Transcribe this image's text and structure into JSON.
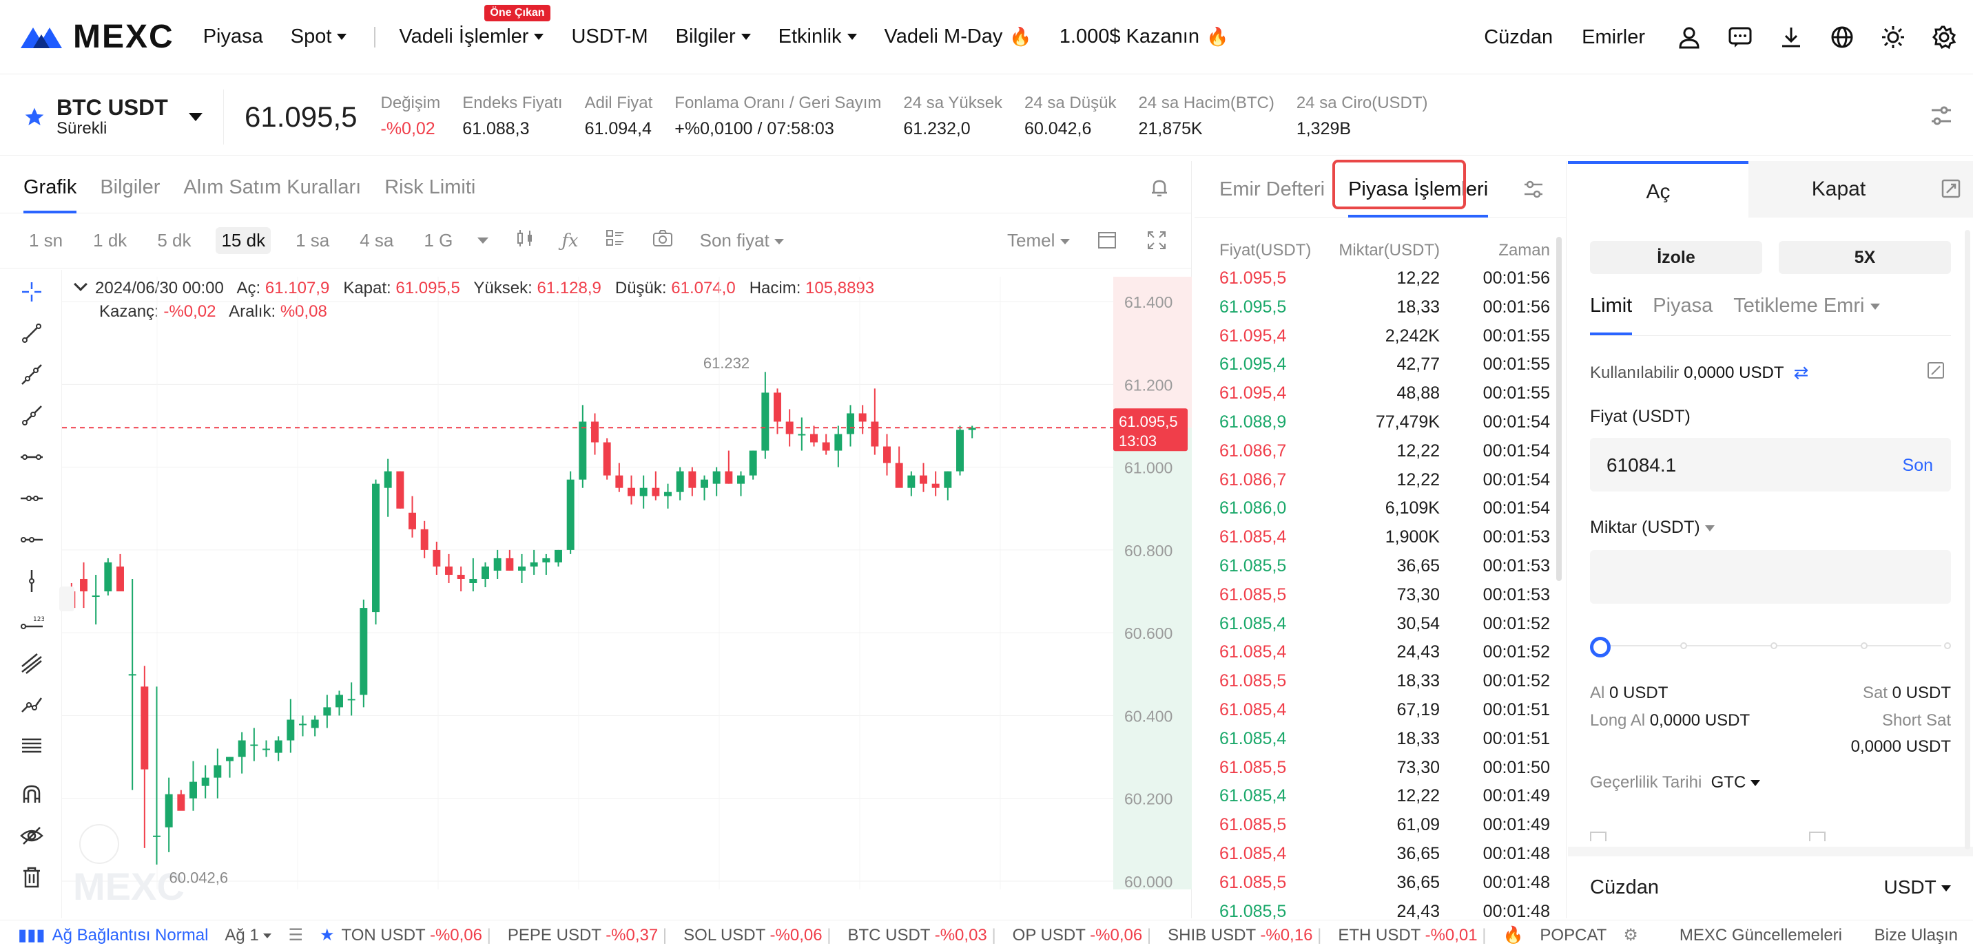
{
  "nav": {
    "logo": "MEXC",
    "items": [
      "Piyasa",
      "Spot",
      "Vadeli İşlemler",
      "USDT-M",
      "Bilgiler",
      "Etkinlik",
      "Vadeli M-Day",
      "1.000$ Kazanın"
    ],
    "badge": "Öne Çıkan",
    "right": [
      "Cüzdan",
      "Emirler"
    ]
  },
  "ticker": {
    "symbol": "BTC USDT",
    "type": "Sürekli",
    "price": "61.095,5",
    "stats": [
      {
        "label": "Değişim",
        "value": "-%0,02",
        "tone": "red"
      },
      {
        "label": "Endeks Fiyatı",
        "value": "61.088,3",
        "tone": ""
      },
      {
        "label": "Adil Fiyat",
        "value": "61.094,4",
        "tone": ""
      },
      {
        "label": "Fonlama Oranı / Geri Sayım",
        "value": "+%0,0100 / 07:58:03",
        "tone": ""
      },
      {
        "label": "24 sa Yüksek",
        "value": "61.232,0",
        "tone": ""
      },
      {
        "label": "24 sa Düşük",
        "value": "60.042,6",
        "tone": ""
      },
      {
        "label": "24 sa Hacim(BTC)",
        "value": "21,875K",
        "tone": ""
      },
      {
        "label": "24 sa Ciro(USDT)",
        "value": "1,329B",
        "tone": ""
      }
    ]
  },
  "chart_tabs": [
    "Grafik",
    "Bilgiler",
    "Alım Satım Kuralları",
    "Risk Limiti"
  ],
  "toolbar": {
    "timeframes": [
      "1 sn",
      "1 dk",
      "5 dk",
      "15 dk",
      "1 sa",
      "4 sa",
      "1 G"
    ],
    "price_type": "Son fiyat",
    "mode": "Temel"
  },
  "ohlc": {
    "date": "2024/06/30 00:00",
    "open_l": "Aç:",
    "open": "61.107,9",
    "close_l": "Kapat:",
    "close": "61.095,5",
    "high_l": "Yüksek:",
    "high": "61.128,9",
    "low_l": "Düşük:",
    "low": "61.074,0",
    "vol_l": "Hacim:",
    "vol": "105,8893",
    "pnl_l": "Kazanç:",
    "pnl": "-%0,02",
    "range_l": "Aralık:",
    "range": "%0,08"
  },
  "chart_data": {
    "type": "candlestick",
    "y_ticks": [
      "61.400",
      "61.200",
      "61.000",
      "60.800",
      "60.600",
      "60.400",
      "60.200",
      "60.000"
    ],
    "ylim": [
      59980,
      61460
    ],
    "last_price": "61.095,5",
    "countdown": "13:03",
    "high_marker": "61.232",
    "low_marker": "60.042,6",
    "watermark": "MEXC",
    "candles": [
      [
        60700,
        60720,
        60690,
        60660
      ],
      [
        60730,
        60770,
        60660,
        60700
      ],
      [
        60690,
        60740,
        60620,
        60690
      ],
      [
        60700,
        60780,
        60690,
        60770
      ],
      [
        60760,
        60790,
        60720,
        60700
      ],
      [
        60500,
        60730,
        60220,
        60500
      ],
      [
        60470,
        60520,
        60080,
        60270
      ],
      [
        60110,
        60470,
        60040,
        60110
      ],
      [
        60130,
        60250,
        60070,
        60210
      ],
      [
        60210,
        60220,
        60190,
        60170
      ],
      [
        60200,
        60290,
        60170,
        60240
      ],
      [
        60230,
        60280,
        60200,
        60250
      ],
      [
        60250,
        60320,
        60200,
        60280
      ],
      [
        60290,
        60300,
        60250,
        60300
      ],
      [
        60300,
        60360,
        60260,
        60340
      ],
      [
        60330,
        60370,
        60290,
        60330
      ],
      [
        60320,
        60340,
        60300,
        60320
      ],
      [
        60310,
        60350,
        60290,
        60340
      ],
      [
        60340,
        60440,
        60310,
        60390
      ],
      [
        60380,
        60400,
        60350,
        60380
      ],
      [
        60370,
        60400,
        60350,
        60390
      ],
      [
        60400,
        60450,
        60370,
        60420
      ],
      [
        60420,
        60460,
        60400,
        60450
      ],
      [
        60440,
        60480,
        60400,
        60440
      ],
      [
        60450,
        60680,
        60420,
        60660
      ],
      [
        60650,
        60970,
        60620,
        60960
      ],
      [
        60950,
        61020,
        60880,
        60990
      ],
      [
        60990,
        60990,
        60900,
        60900
      ],
      [
        60890,
        60930,
        60830,
        60850
      ],
      [
        60850,
        60870,
        60780,
        60800
      ],
      [
        60800,
        60820,
        60740,
        60760
      ],
      [
        60760,
        60790,
        60720,
        60740
      ],
      [
        60740,
        60760,
        60700,
        60730
      ],
      [
        60720,
        60780,
        60700,
        60730
      ],
      [
        60730,
        60770,
        60710,
        60760
      ],
      [
        60750,
        60800,
        60730,
        60780
      ],
      [
        60780,
        60800,
        60750,
        60750
      ],
      [
        60750,
        60790,
        60720,
        60760
      ],
      [
        60760,
        60800,
        60740,
        60770
      ],
      [
        60770,
        60790,
        60740,
        60780
      ],
      [
        60770,
        60800,
        60760,
        60800
      ],
      [
        60800,
        60990,
        60790,
        60970
      ],
      [
        60970,
        61150,
        60950,
        61110
      ],
      [
        61110,
        61130,
        61030,
        61060
      ],
      [
        61060,
        61070,
        60970,
        60980
      ],
      [
        60980,
        61010,
        60940,
        60950
      ],
      [
        60950,
        60980,
        60910,
        60930
      ],
      [
        60930,
        60980,
        60900,
        60950
      ],
      [
        60950,
        60990,
        60920,
        60930
      ],
      [
        60930,
        60960,
        60900,
        60940
      ],
      [
        60940,
        61000,
        60920,
        60990
      ],
      [
        60990,
        61000,
        60930,
        60950
      ],
      [
        60950,
        60980,
        60920,
        60970
      ],
      [
        60960,
        61000,
        60930,
        60990
      ],
      [
        60990,
        61040,
        60960,
        60960
      ],
      [
        60960,
        60990,
        60930,
        60980
      ],
      [
        60980,
        61040,
        60970,
        61040
      ],
      [
        61040,
        61230,
        61020,
        61180
      ],
      [
        61180,
        61190,
        61080,
        61110
      ],
      [
        61110,
        61140,
        61050,
        61080
      ],
      [
        61080,
        61120,
        61040,
        61080
      ],
      [
        61080,
        61100,
        61050,
        61060
      ],
      [
        61060,
        61080,
        61030,
        61040
      ],
      [
        61040,
        61100,
        61000,
        61080
      ],
      [
        61080,
        61150,
        61050,
        61130
      ],
      [
        61130,
        61150,
        61080,
        61110
      ],
      [
        61110,
        61190,
        61030,
        61050
      ],
      [
        61050,
        61080,
        60980,
        61010
      ],
      [
        61010,
        61050,
        60970,
        60950
      ],
      [
        60950,
        60990,
        60930,
        60980
      ],
      [
        60980,
        61010,
        60940,
        60960
      ],
      [
        60960,
        60990,
        60930,
        60950
      ],
      [
        60950,
        60990,
        60920,
        60990
      ],
      [
        60990,
        61100,
        60980,
        61090
      ],
      [
        61090,
        61100,
        61070,
        61095
      ]
    ]
  },
  "mid_tabs": [
    "Emir Defteri",
    "Piyasa İşlemleri"
  ],
  "trades": {
    "headers": [
      "Fiyat(USDT)",
      "Miktar(USDT)",
      "Zaman"
    ],
    "rows": [
      {
        "p": "61.095,5",
        "q": "12,22",
        "t": "00:01:56",
        "s": "red"
      },
      {
        "p": "61.095,5",
        "q": "18,33",
        "t": "00:01:56",
        "s": "green"
      },
      {
        "p": "61.095,4",
        "q": "2,242K",
        "t": "00:01:55",
        "s": "red"
      },
      {
        "p": "61.095,4",
        "q": "42,77",
        "t": "00:01:55",
        "s": "green"
      },
      {
        "p": "61.095,4",
        "q": "48,88",
        "t": "00:01:55",
        "s": "red"
      },
      {
        "p": "61.088,9",
        "q": "77,479K",
        "t": "00:01:54",
        "s": "green"
      },
      {
        "p": "61.086,7",
        "q": "12,22",
        "t": "00:01:54",
        "s": "red"
      },
      {
        "p": "61.086,7",
        "q": "12,22",
        "t": "00:01:54",
        "s": "red"
      },
      {
        "p": "61.086,0",
        "q": "6,109K",
        "t": "00:01:54",
        "s": "green"
      },
      {
        "p": "61.085,4",
        "q": "1,900K",
        "t": "00:01:53",
        "s": "red"
      },
      {
        "p": "61.085,5",
        "q": "36,65",
        "t": "00:01:53",
        "s": "green"
      },
      {
        "p": "61.085,5",
        "q": "73,30",
        "t": "00:01:53",
        "s": "red"
      },
      {
        "p": "61.085,4",
        "q": "30,54",
        "t": "00:01:52",
        "s": "green"
      },
      {
        "p": "61.085,4",
        "q": "24,43",
        "t": "00:01:52",
        "s": "red"
      },
      {
        "p": "61.085,5",
        "q": "18,33",
        "t": "00:01:52",
        "s": "red"
      },
      {
        "p": "61.085,4",
        "q": "67,19",
        "t": "00:01:51",
        "s": "red"
      },
      {
        "p": "61.085,4",
        "q": "18,33",
        "t": "00:01:51",
        "s": "green"
      },
      {
        "p": "61.085,5",
        "q": "73,30",
        "t": "00:01:50",
        "s": "red"
      },
      {
        "p": "61.085,4",
        "q": "12,22",
        "t": "00:01:49",
        "s": "green"
      },
      {
        "p": "61.085,5",
        "q": "61,09",
        "t": "00:01:49",
        "s": "red"
      },
      {
        "p": "61.085,4",
        "q": "36,65",
        "t": "00:01:48",
        "s": "red"
      },
      {
        "p": "61.085,5",
        "q": "36,65",
        "t": "00:01:48",
        "s": "red"
      },
      {
        "p": "61.085,5",
        "q": "24,43",
        "t": "00:01:48",
        "s": "green"
      }
    ]
  },
  "order": {
    "tab_open": "Aç",
    "tab_close": "Kapat",
    "margin_mode": "İzole",
    "leverage": "5X",
    "types": [
      "Limit",
      "Piyasa",
      "Tetikleme Emri"
    ],
    "available_label": "Kullanılabilir",
    "available": "0,0000 USDT",
    "price_label": "Fiyat (USDT)",
    "price_value": "61084.1",
    "price_btn": "Son",
    "qty_label": "Miktar (USDT)",
    "buy_label": "Al",
    "buy_value": "0 USDT",
    "sell_label": "Sat",
    "sell_value": "0 USDT",
    "long_label": "Long Al",
    "long_value": "0,0000 USDT",
    "short_label": "Short Sat",
    "short_value": "0,0000 USDT",
    "validity_label": "Geçerlilik Tarihi",
    "validity_value": "GTC",
    "slider_value": 0,
    "wallet_label": "Cüzdan",
    "wallet_currency": "USDT"
  },
  "footer": {
    "network": "Ağ Bağlantısı Normal",
    "node": "Ağ 1",
    "tickers": [
      {
        "sym": "TON USDT",
        "chg": "-%0,06"
      },
      {
        "sym": "PEPE USDT",
        "chg": "-%0,37"
      },
      {
        "sym": "SOL USDT",
        "chg": "-%0,06"
      },
      {
        "sym": "BTC USDT",
        "chg": "-%0,03"
      },
      {
        "sym": "OP USDT",
        "chg": "-%0,06"
      },
      {
        "sym": "SHIB USDT",
        "chg": "-%0,16"
      },
      {
        "sym": "ETH USDT",
        "chg": "-%0,01"
      }
    ],
    "promo": "POPCAT",
    "news": "MEXC Güncellemeleri",
    "contact": "Bize Ulaşın"
  }
}
